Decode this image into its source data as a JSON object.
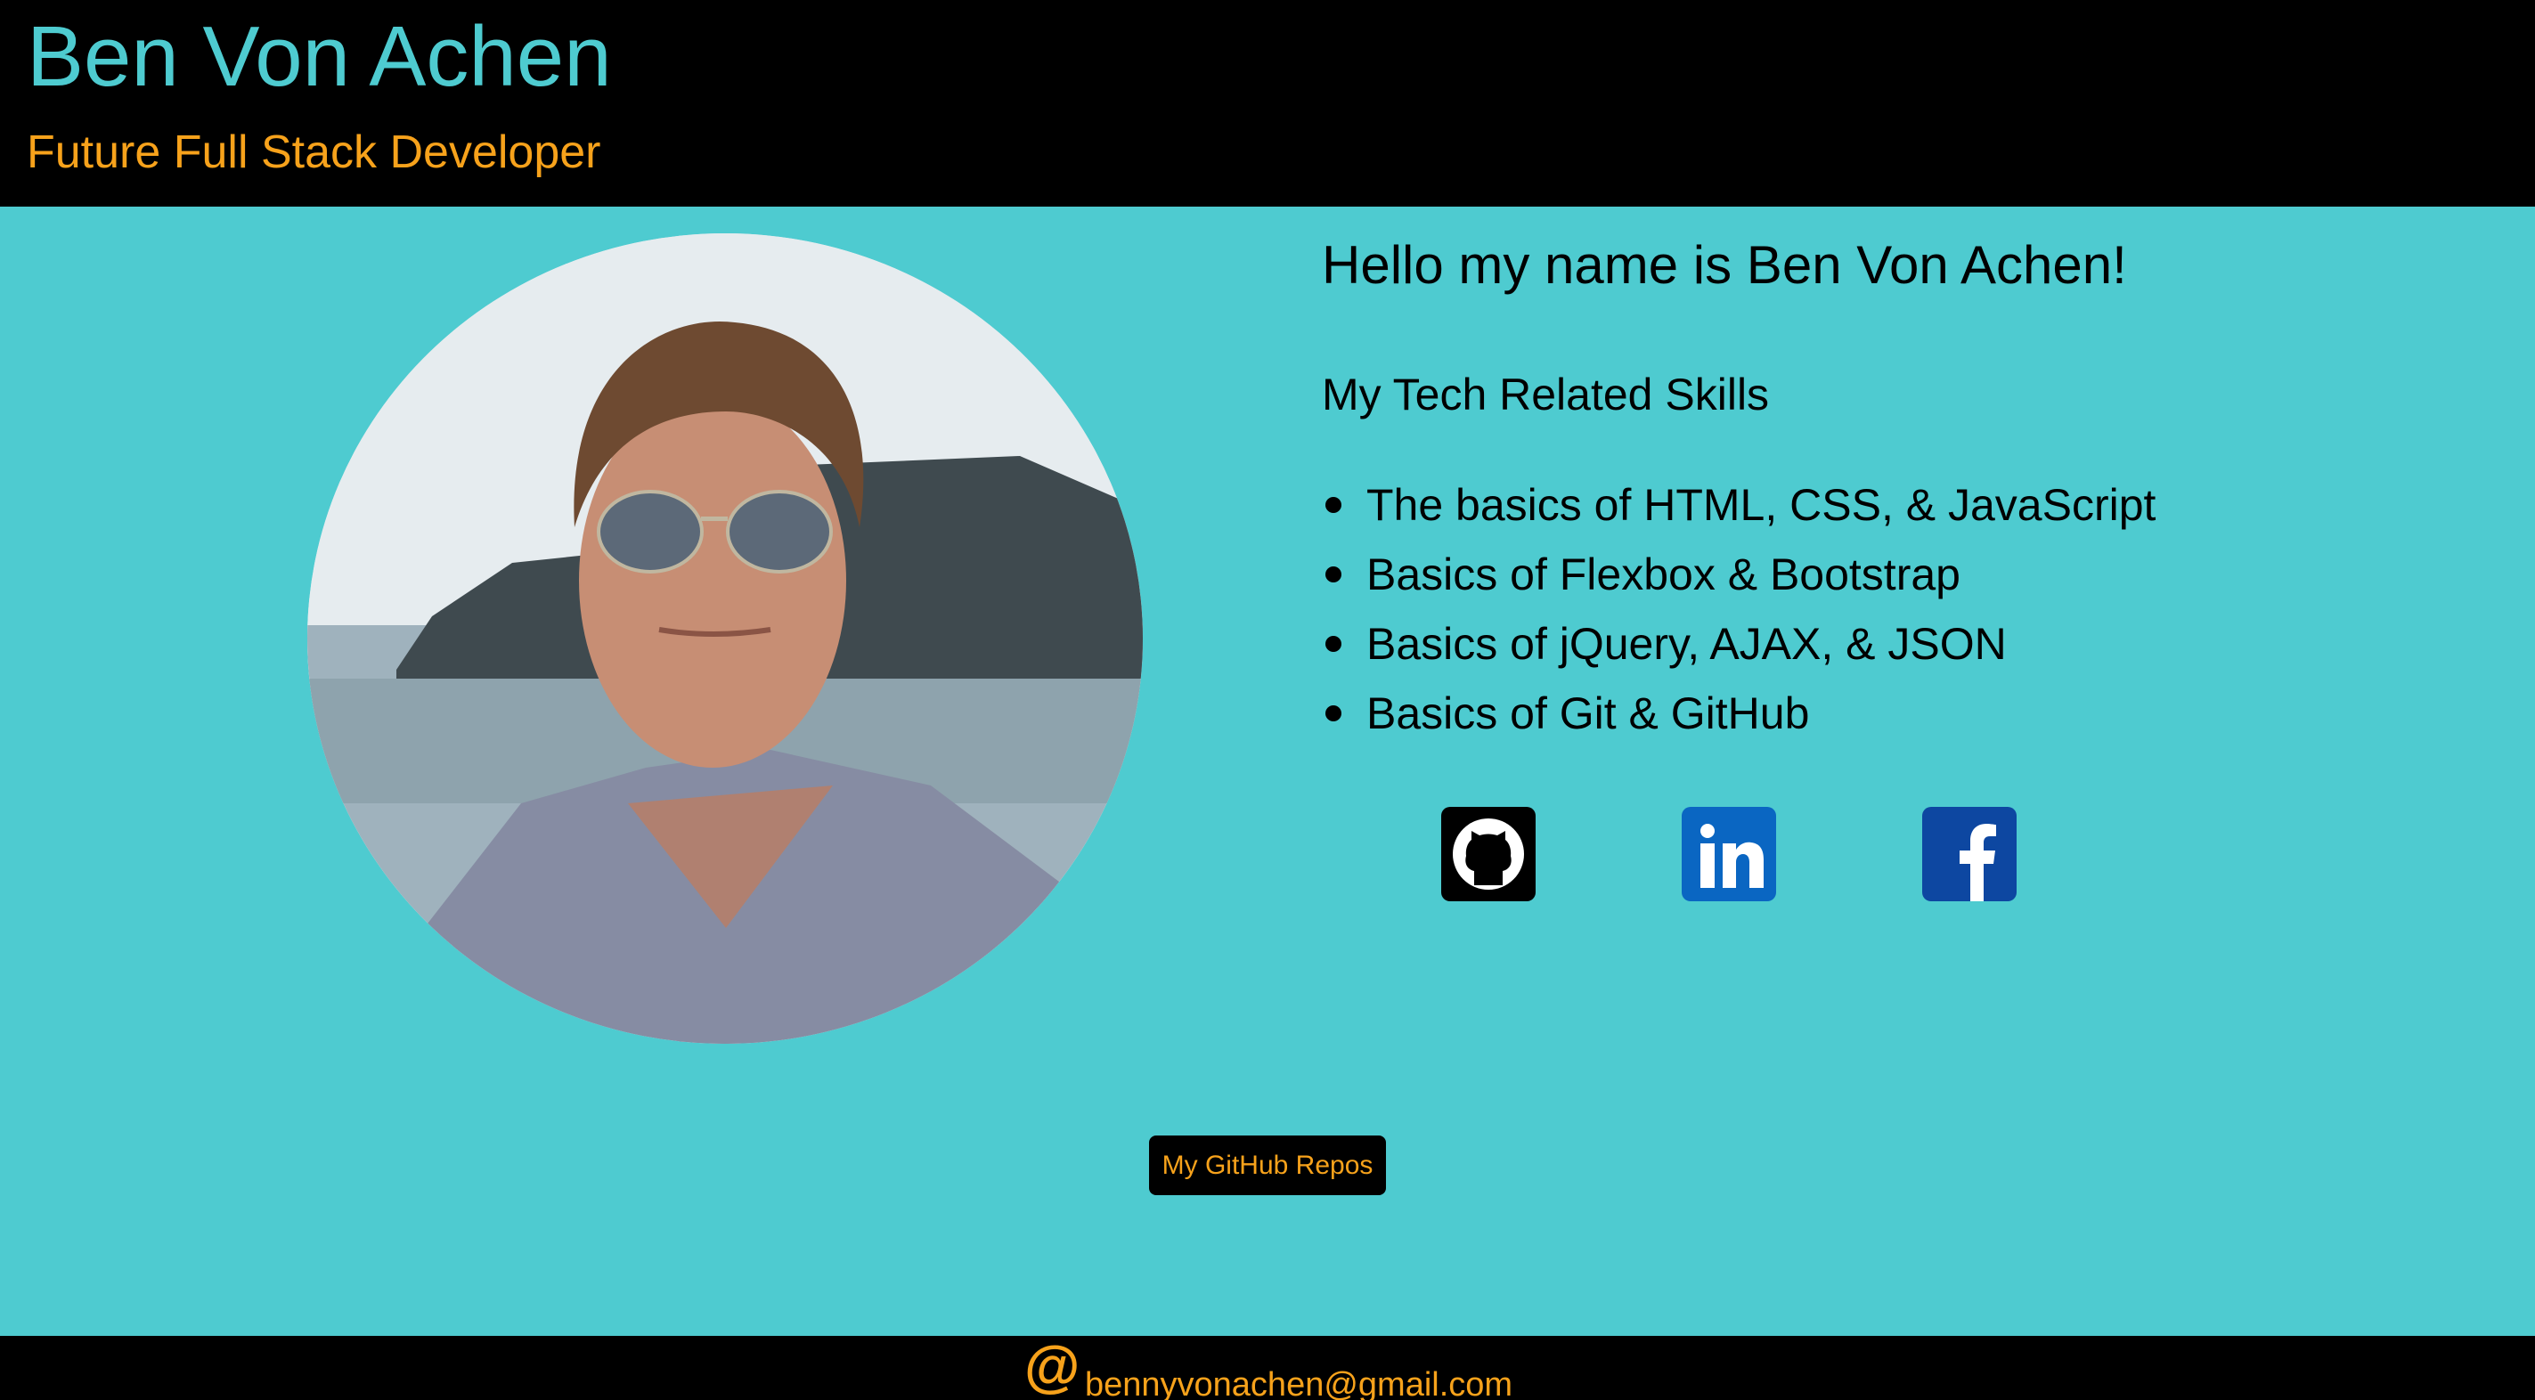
{
  "header": {
    "title": "Ben Von Achen",
    "subtitle": "Future Full Stack Developer"
  },
  "profile": {
    "photo_icon": "profile-photo",
    "greeting": "Hello my name is Ben Von Achen!",
    "skills_heading": "My Tech Related Skills",
    "skills": [
      "The basics of HTML, CSS, & JavaScript",
      "Basics of Flexbox & Bootstrap",
      "Basics of jQuery, AJAX, & JSON",
      "Basics of Git & GitHub"
    ]
  },
  "social": [
    {
      "name": "github",
      "icon": "github-icon",
      "color": "#000000"
    },
    {
      "name": "linkedin",
      "icon": "linkedin-icon",
      "color": "#0a66c2"
    },
    {
      "name": "facebook",
      "icon": "facebook-icon",
      "color": "#0d47a1"
    }
  ],
  "repos_button": {
    "label": "My GitHub Repos"
  },
  "footer": {
    "at_symbol": "@",
    "email": "bennyvonachen@gmail.com"
  },
  "colors": {
    "background": "#4ecbd0",
    "header": "#000000",
    "accent": "#f7a21b",
    "title": "#4ecbd0"
  }
}
